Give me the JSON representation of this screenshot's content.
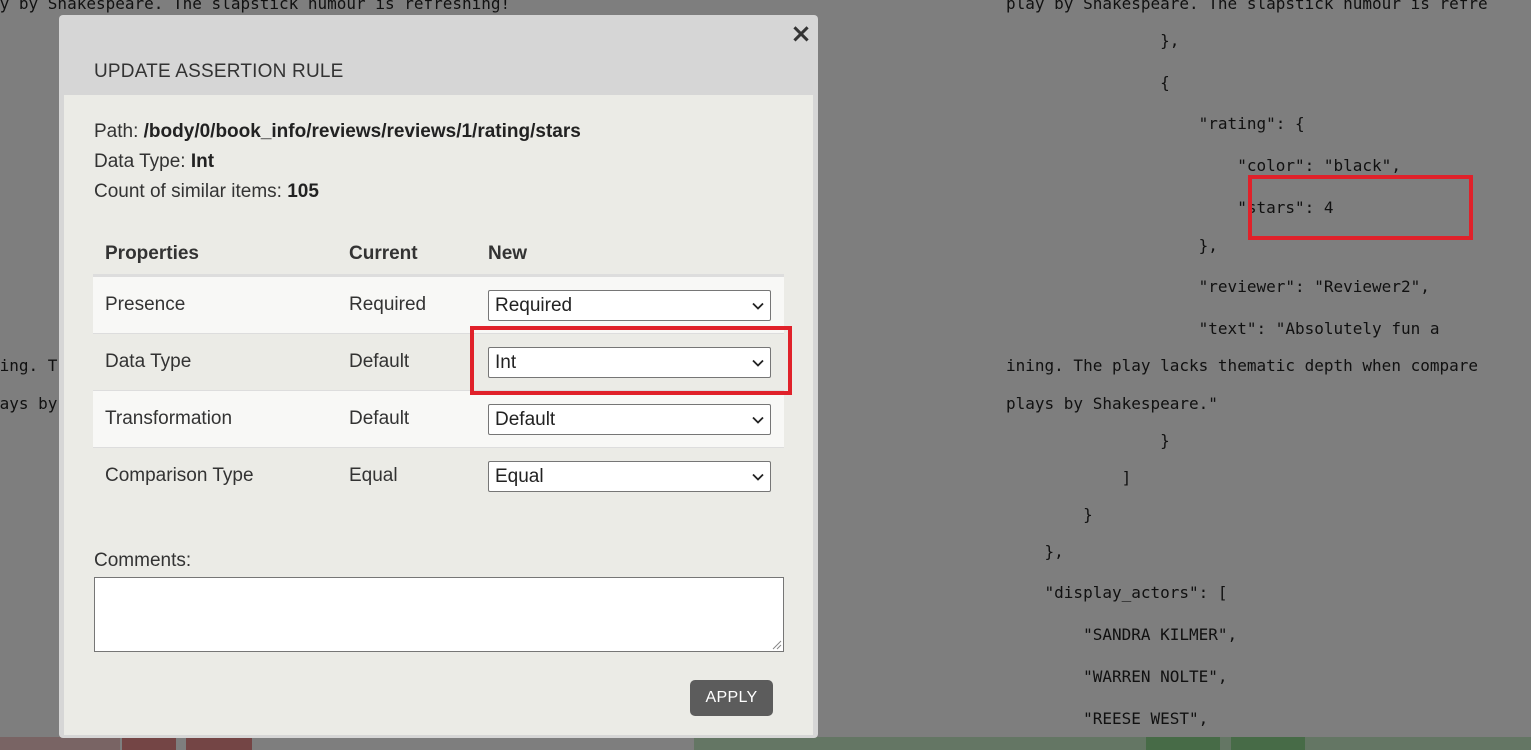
{
  "background": {
    "left_code_lines": [
      "ay by Shakespeare. The slapstick humour is refreshing!",
      "ning. T",
      "lays by"
    ],
    "right_code_lines": [
      "play by Shakespeare. The slapstick humour is refre",
      "                },",
      "                {",
      "                    \"rating\": {",
      "                        \"color\": \"black\",",
      "                        \"stars\": 4",
      "                    },",
      "                    \"reviewer\": \"Reviewer2\",",
      "                    \"text\": \"Absolutely fun a",
      "ining. The play lacks thematic depth when compare",
      "plays by Shakespeare.\"",
      "                }",
      "            ]",
      "        }",
      "    },",
      "    \"display_actors\": [",
      "        \"SANDRA KILMER\",",
      "        \"WARREN NOLTE\",",
      "        \"REESE WEST\","
    ]
  },
  "modal": {
    "close_label": "×",
    "title": "UPDATE ASSERTION RULE",
    "path_label": "Path: ",
    "path_value": "/body/0/book_info/reviews/reviews/1/rating/stars",
    "data_type_label": "Data Type: ",
    "data_type_value": "Int",
    "count_label": "Count of similar items: ",
    "count_value": "105",
    "table": {
      "headers": [
        "Properties",
        "Current",
        "New"
      ],
      "rows": [
        {
          "property": "Presence",
          "current": "Required",
          "new": "Required"
        },
        {
          "property": "Data Type",
          "current": "Default",
          "new": "Int"
        },
        {
          "property": "Transformation",
          "current": "Default",
          "new": "Default"
        },
        {
          "property": "Comparison Type",
          "current": "Equal",
          "new": "Equal"
        }
      ]
    },
    "comments_label": "Comments:",
    "comments_value": "",
    "apply_label": "APPLY"
  },
  "colors": {
    "highlight": "#e0212a",
    "apply_button": "#5c5c5c",
    "overlay": "rgba(0,0,0,0.5)"
  }
}
